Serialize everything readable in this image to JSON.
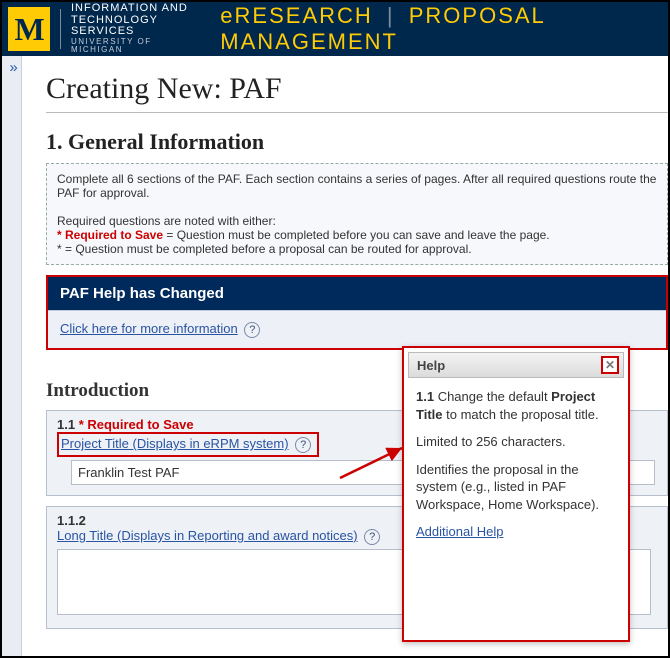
{
  "header": {
    "logo_letter": "M",
    "its_line1": "INFORMATION AND",
    "its_line2": "TECHNOLOGY SERVICES",
    "its_line3": "UNIVERSITY OF MICHIGAN",
    "brand_left": "eRESEARCH",
    "brand_sep": "|",
    "brand_right": "PROPOSAL MANAGEMENT"
  },
  "sidebar": {
    "expand_glyph": "»"
  },
  "page": {
    "title": "Creating New: PAF",
    "section_heading": "1. General Information",
    "instructions": {
      "p1": "Complete all 6 sections of the PAF. Each section contains a series of pages. After all required questions route the PAF for approval.",
      "p2": "Required questions are noted with either:",
      "req_save_label": "* Required to Save",
      "req_save_rest": "= Question must be completed before you can save and leave the page.",
      "star_line": "*  = Question must be completed before a proposal can be routed for approval."
    }
  },
  "paf_help": {
    "title": "PAF Help has Changed",
    "link_text": "Click here for more information"
  },
  "intro": {
    "heading": "Introduction",
    "q11": {
      "num": "1.1",
      "req": "* Required to Save",
      "label": "Project Title (Displays in eRPM system)",
      "value": "Franklin Test PAF"
    },
    "q112": {
      "num": "1.1.2",
      "label": "Long Title (Displays in Reporting and award notices)",
      "value": ""
    }
  },
  "help_popup": {
    "title": "Help",
    "line1a": "1.1",
    "line1b": " Change the default ",
    "line1c": "Project Title",
    "line1d": " to match the proposal title.",
    "line2": "Limited to 256 characters.",
    "line3": "Identifies the proposal in the system (e.g., listed in PAF Workspace, Home Workspace).",
    "link": "Additional Help"
  }
}
